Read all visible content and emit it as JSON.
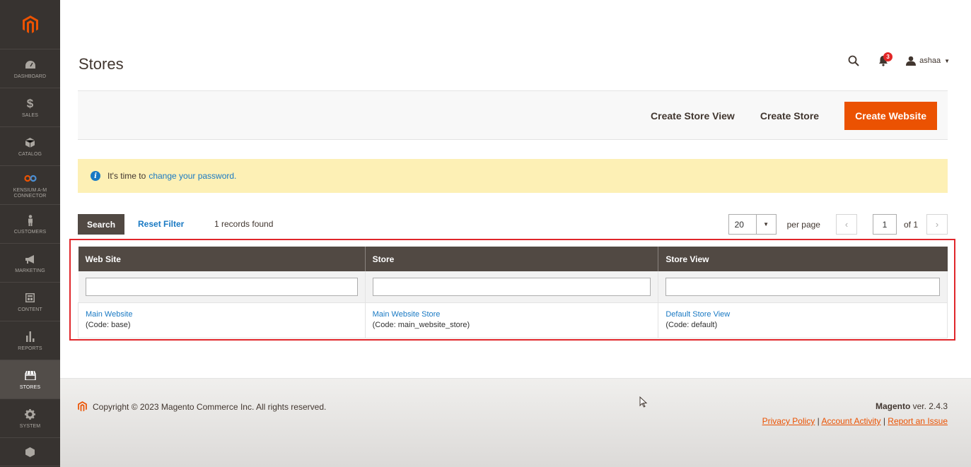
{
  "sidebar": {
    "items": [
      {
        "label": "DASHBOARD",
        "icon": "dashboard-icon"
      },
      {
        "label": "SALES",
        "icon": "dollar-icon"
      },
      {
        "label": "CATALOG",
        "icon": "box-icon"
      },
      {
        "label": "KENSIUM A-M CONNECTOR",
        "icon": "infinity-icon"
      },
      {
        "label": "CUSTOMERS",
        "icon": "person-icon"
      },
      {
        "label": "MARKETING",
        "icon": "megaphone-icon"
      },
      {
        "label": "CONTENT",
        "icon": "layout-icon"
      },
      {
        "label": "REPORTS",
        "icon": "bar-chart-icon"
      },
      {
        "label": "STORES",
        "icon": "store-icon"
      },
      {
        "label": "SYSTEM",
        "icon": "gear-icon"
      }
    ]
  },
  "header": {
    "title": "Stores",
    "notification_count": "3",
    "username": "ashaa"
  },
  "actions": {
    "create_store_view": "Create Store View",
    "create_store": "Create Store",
    "create_website": "Create Website"
  },
  "notice": {
    "text": "It's time to",
    "link": "change your password."
  },
  "toolbar": {
    "search": "Search",
    "reset_filter": "Reset Filter",
    "records_found": "1 records found",
    "per_page_value": "20",
    "per_page_label": "per page",
    "current_page": "1",
    "of_pages": "of 1"
  },
  "grid": {
    "columns": [
      "Web Site",
      "Store",
      "Store View"
    ],
    "rows": [
      {
        "website": "Main Website",
        "website_code": "(Code: base)",
        "store": "Main Website Store",
        "store_code": "(Code: main_website_store)",
        "store_view": "Default Store View",
        "store_view_code": "(Code: default)"
      }
    ]
  },
  "footer": {
    "copyright": "Copyright © 2023 Magento Commerce Inc. All rights reserved.",
    "brand": "Magento",
    "version": " ver. 2.4.3",
    "privacy": "Privacy Policy",
    "activity": "Account Activity",
    "report": "Report an Issue",
    "separator": " | "
  },
  "colors": {
    "accent": "#eb5202",
    "sidebar": "#373330",
    "link": "#1979c3",
    "highlight": "#e0262b"
  }
}
